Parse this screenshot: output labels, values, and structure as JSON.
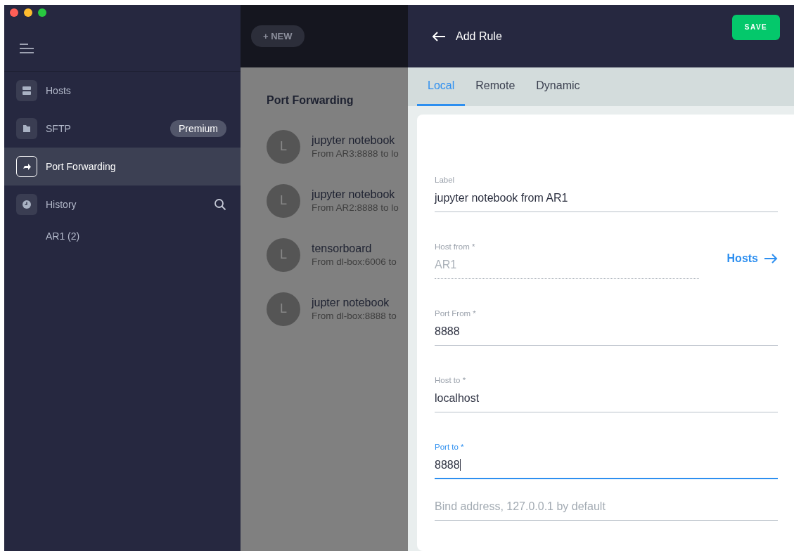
{
  "sidebar": {
    "items": [
      {
        "label": "Hosts",
        "kind": "server",
        "selected": false
      },
      {
        "label": "SFTP",
        "kind": "folder",
        "selected": false,
        "badge": "Premium"
      },
      {
        "label": "Port Forwarding",
        "kind": "forward",
        "selected": true
      },
      {
        "label": "History",
        "kind": "clock",
        "selected": false,
        "search": true
      }
    ],
    "history_entries": [
      "AR1 (2)"
    ]
  },
  "list": {
    "new_button": "+ NEW",
    "title": "Port Forwarding",
    "rules": [
      {
        "avatar": "L",
        "name": "jupyter notebook",
        "detail": "From AR3:8888 to lo"
      },
      {
        "avatar": "L",
        "name": "jupyter notebook",
        "detail": "From AR2:8888 to lo"
      },
      {
        "avatar": "L",
        "name": "tensorboard",
        "detail": "From dl-box:6006 to"
      },
      {
        "avatar": "L",
        "name": "jupter notebook",
        "detail": "From dl-box:8888 to"
      }
    ]
  },
  "panel": {
    "title": "Add Rule",
    "save_button": "SAVE",
    "tabs": [
      {
        "label": "Local",
        "selected": true
      },
      {
        "label": "Remote",
        "selected": false
      },
      {
        "label": "Dynamic",
        "selected": false
      }
    ],
    "fields": [
      {
        "label": "Label",
        "value": "jupyter notebook from AR1",
        "disabled": false,
        "focused": false
      },
      {
        "label": "Host from *",
        "value": "AR1",
        "disabled": true,
        "focused": false,
        "link": "Hosts"
      },
      {
        "label": "Port From *",
        "value": "8888",
        "disabled": false,
        "focused": false
      },
      {
        "label": "Host to *",
        "value": "localhost",
        "disabled": false,
        "focused": false
      },
      {
        "label": "Port to *",
        "value": "8888",
        "disabled": false,
        "focused": true
      },
      {
        "placeholder": "Bind address, 127.0.0.1 by default",
        "disabled": false,
        "focused": false
      }
    ]
  }
}
